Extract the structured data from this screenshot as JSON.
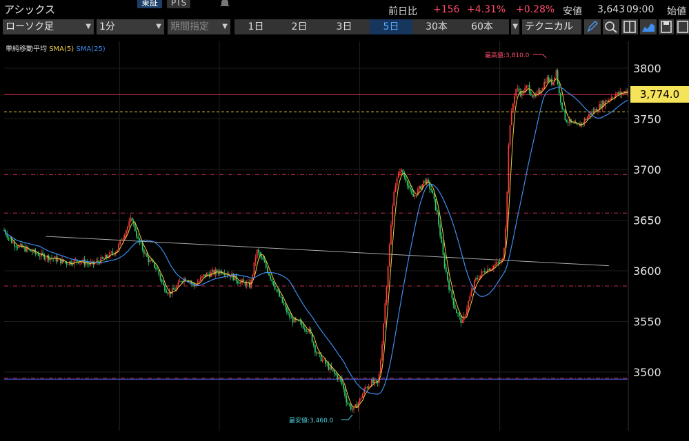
{
  "header": {
    "stock_name": "アシックス",
    "market_tabs": [
      "東証",
      "PTS"
    ],
    "change_label": "前日比",
    "change_value": "+156",
    "change_pct": "+4.31%",
    "change_pct2": "+0.28%",
    "low_label": "安値",
    "low_value": "3,643",
    "time": "09:00",
    "open_label": "始値"
  },
  "toolbar": {
    "chart_type": "ローソク足",
    "interval": "1分",
    "period_placeholder": "期間指定",
    "ranges": [
      "1日",
      "2日",
      "3日",
      "5日",
      "30本",
      "60本"
    ],
    "active_range": "5日",
    "technical": "テクニカル"
  },
  "legend": {
    "title": "単純移動平均",
    "sma5": "SMA(5)",
    "sma25": "SMA(25)"
  },
  "colors": {
    "up": "#ff3b3b",
    "down": "#2ecc71",
    "sma5": "#f0d040",
    "sma25": "#3d8ef0",
    "positive": "#ff4d6d",
    "price_tag": "#f5e35a",
    "active_tab": "#16365e"
  },
  "icons": [
    "bell-icon",
    "pencil-icon",
    "zoom-icon",
    "split-window-icon",
    "area-chart-icon",
    "save-icon",
    "layout-icon"
  ],
  "chart_data": {
    "type": "line",
    "x_unit": "1分足",
    "ylim": [
      3445,
      3828
    ],
    "yticks": [
      3500,
      3550,
      3600,
      3650,
      3700,
      3750,
      3800
    ],
    "current_price": 3774.0,
    "current_price_label": "3,774.0",
    "max_annotation": "最高値:3,810.0",
    "min_annotation": "最安値:3,460.0",
    "horizontal_lines": [
      3774,
      3757,
      3695,
      3657,
      3585,
      3494,
      3493
    ],
    "trendline": {
      "from": [
        0.067,
        3634
      ],
      "to": [
        0.97,
        3605
      ]
    },
    "session_boundaries": [
      0.185,
      0.345,
      0.57,
      0.795
    ],
    "price_path": [
      [
        0.0,
        3640
      ],
      [
        0.01,
        3630
      ],
      [
        0.02,
        3625
      ],
      [
        0.04,
        3620
      ],
      [
        0.06,
        3615
      ],
      [
        0.08,
        3612
      ],
      [
        0.1,
        3608
      ],
      [
        0.12,
        3610
      ],
      [
        0.14,
        3606
      ],
      [
        0.16,
        3612
      ],
      [
        0.18,
        3620
      ],
      [
        0.195,
        3640
      ],
      [
        0.205,
        3652
      ],
      [
        0.215,
        3630
      ],
      [
        0.23,
        3612
      ],
      [
        0.245,
        3602
      ],
      [
        0.255,
        3585
      ],
      [
        0.265,
        3578
      ],
      [
        0.275,
        3582
      ],
      [
        0.285,
        3592
      ],
      [
        0.295,
        3592
      ],
      [
        0.305,
        3585
      ],
      [
        0.32,
        3595
      ],
      [
        0.335,
        3598
      ],
      [
        0.35,
        3600
      ],
      [
        0.365,
        3595
      ],
      [
        0.375,
        3590
      ],
      [
        0.385,
        3588
      ],
      [
        0.395,
        3585
      ],
      [
        0.405,
        3620
      ],
      [
        0.415,
        3610
      ],
      [
        0.43,
        3590
      ],
      [
        0.445,
        3570
      ],
      [
        0.46,
        3552
      ],
      [
        0.475,
        3548
      ],
      [
        0.49,
        3540
      ],
      [
        0.5,
        3520
      ],
      [
        0.51,
        3512
      ],
      [
        0.52,
        3505
      ],
      [
        0.53,
        3498
      ],
      [
        0.54,
        3492
      ],
      [
        0.55,
        3470
      ],
      [
        0.56,
        3462
      ],
      [
        0.57,
        3472
      ],
      [
        0.58,
        3485
      ],
      [
        0.59,
        3490
      ],
      [
        0.6,
        3488
      ],
      [
        0.605,
        3520
      ],
      [
        0.615,
        3600
      ],
      [
        0.625,
        3680
      ],
      [
        0.635,
        3700
      ],
      [
        0.645,
        3690
      ],
      [
        0.655,
        3672
      ],
      [
        0.665,
        3680
      ],
      [
        0.675,
        3690
      ],
      [
        0.685,
        3680
      ],
      [
        0.695,
        3655
      ],
      [
        0.705,
        3610
      ],
      [
        0.715,
        3580
      ],
      [
        0.725,
        3560
      ],
      [
        0.735,
        3548
      ],
      [
        0.745,
        3570
      ],
      [
        0.755,
        3590
      ],
      [
        0.77,
        3600
      ],
      [
        0.785,
        3605
      ],
      [
        0.8,
        3610
      ],
      [
        0.805,
        3650
      ],
      [
        0.81,
        3740
      ],
      [
        0.82,
        3780
      ],
      [
        0.83,
        3775
      ],
      [
        0.84,
        3782
      ],
      [
        0.85,
        3770
      ],
      [
        0.86,
        3778
      ],
      [
        0.87,
        3790
      ],
      [
        0.88,
        3785
      ],
      [
        0.885,
        3800
      ],
      [
        0.89,
        3775
      ],
      [
        0.9,
        3750
      ],
      [
        0.91,
        3745
      ],
      [
        0.92,
        3742
      ],
      [
        0.93,
        3748
      ],
      [
        0.94,
        3755
      ],
      [
        0.95,
        3760
      ],
      [
        0.96,
        3765
      ],
      [
        0.97,
        3770
      ],
      [
        0.98,
        3774
      ],
      [
        0.99,
        3775
      ],
      [
        1.0,
        3778
      ]
    ]
  }
}
